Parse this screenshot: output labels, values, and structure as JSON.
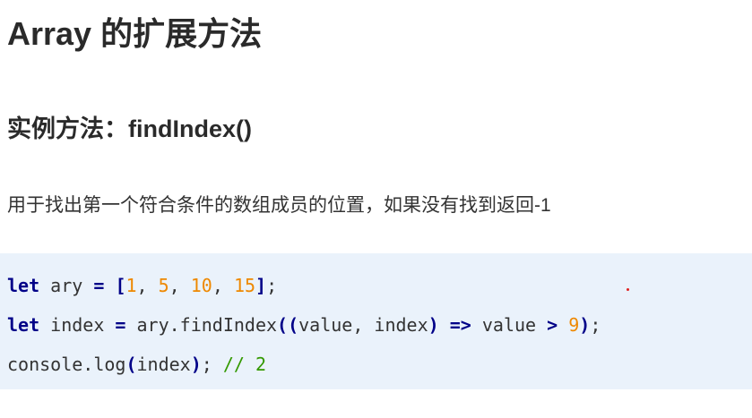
{
  "title": "Array 的扩展方法",
  "subtitle": "实例方法：findIndex()",
  "description": "用于找出第一个符合条件的数组成员的位置，如果没有找到返回-1",
  "code": {
    "line1": {
      "kw": "let",
      "plain1": " ary ",
      "eq": "=",
      "space": " ",
      "open": "[",
      "n1": "1",
      "c1": ", ",
      "n2": "5",
      "c2": ", ",
      "n3": "10",
      "c3": ", ",
      "n4": "15",
      "close": "]",
      "semi": ";"
    },
    "line2": {
      "kw": "let",
      "plain1": " index ",
      "eq": "=",
      "plain2": " ary.findIndex",
      "open": "((",
      "plain3": "value, index",
      "close1": ")",
      "space1": " ",
      "arrow": "=>",
      "plain4": " value ",
      "gt": ">",
      "space2": " ",
      "num": "9",
      "close2": ")",
      "semi": ";"
    },
    "line3": {
      "plain1": "console.log",
      "open": "(",
      "plain2": "index",
      "close": ")",
      "semi": ";",
      "space": " ",
      "comment": "// 2"
    }
  },
  "colors": {
    "keyword": "#000088",
    "number": "#ee8800",
    "comment": "#339900",
    "code_background": "#eaf2fb"
  }
}
